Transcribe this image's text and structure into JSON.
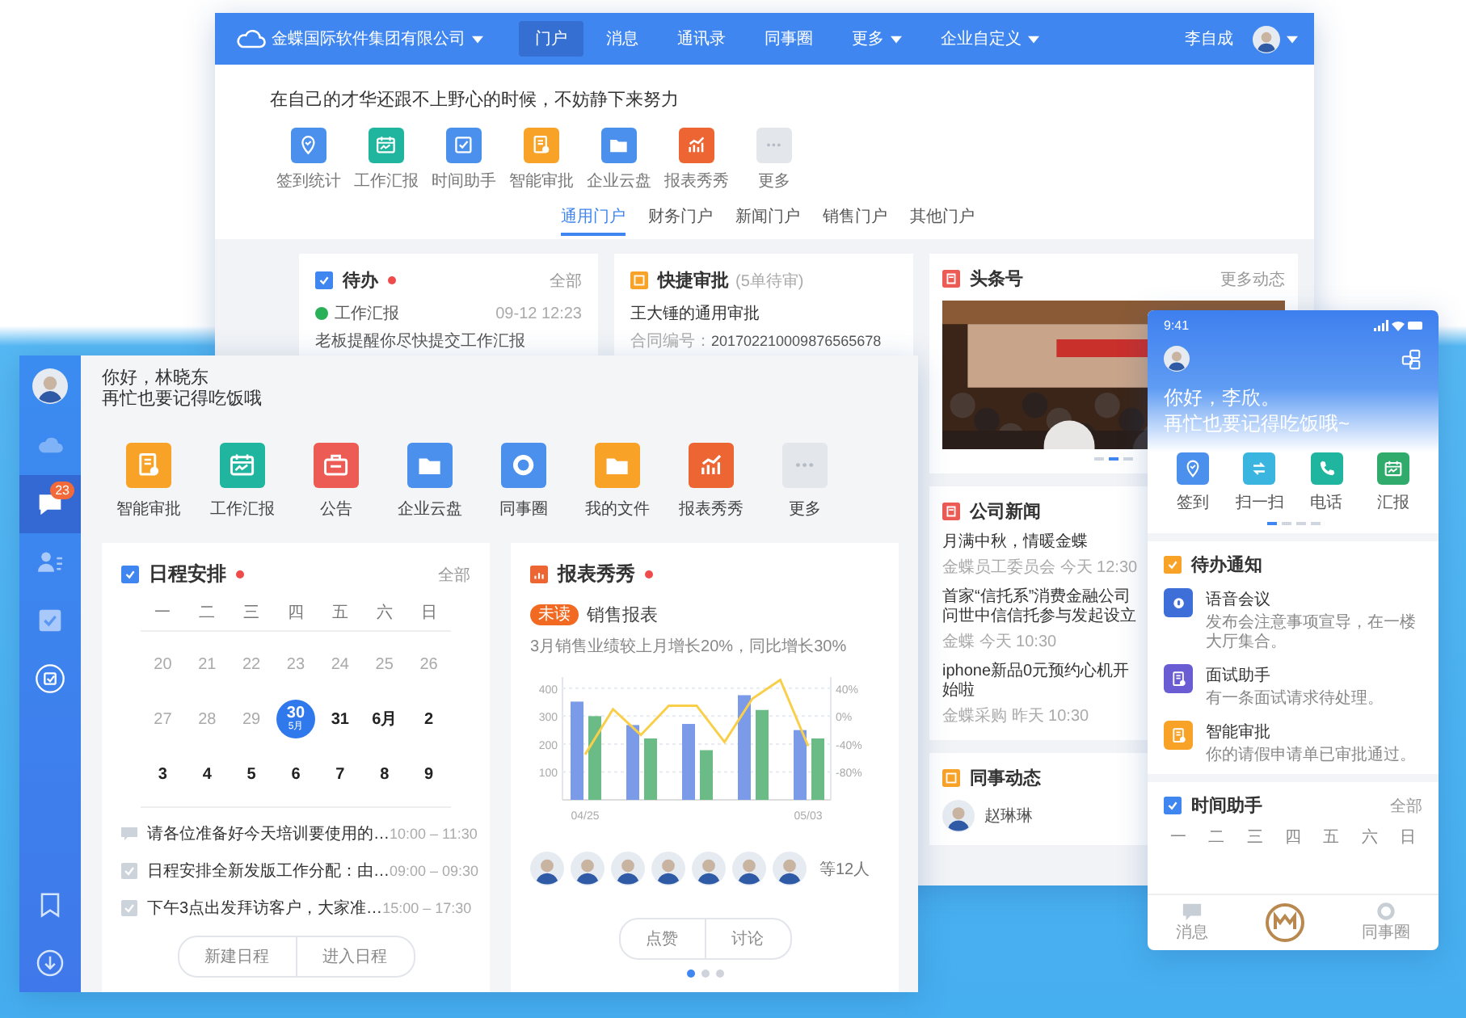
{
  "desktop_window": {
    "company": "金蝶国际软件集团有限公司",
    "nav": [
      {
        "label": "门户",
        "selected": true,
        "dropdown": false
      },
      {
        "label": "消息",
        "selected": false,
        "dropdown": false
      },
      {
        "label": "通讯录",
        "selected": false,
        "dropdown": false
      },
      {
        "label": "同事圈",
        "selected": false,
        "dropdown": false
      },
      {
        "label": "更多",
        "selected": false,
        "dropdown": true
      },
      {
        "label": "企业自定义",
        "selected": false,
        "dropdown": true
      }
    ],
    "user": "李自成",
    "slogan": "在自己的才华还跟不上野心的时候，不妨静下来努力",
    "apps": [
      "签到统计",
      "工作汇报",
      "时间助手",
      "智能审批",
      "企业云盘",
      "报表秀秀",
      "更多"
    ],
    "portal_tabs": [
      {
        "label": "通用门户",
        "selected": true
      },
      {
        "label": "财务门户",
        "selected": false
      },
      {
        "label": "新闻门户",
        "selected": false
      },
      {
        "label": "销售门户",
        "selected": false
      },
      {
        "label": "其他门户",
        "selected": false
      }
    ],
    "todo": {
      "title": "待办",
      "unread": true,
      "more": "全部",
      "item": {
        "title": "工作汇报",
        "time": "09-12 12:23",
        "text": "老板提醒你尽快提交工作汇报"
      }
    },
    "approval": {
      "title": "快捷审批",
      "note": "(5单待审)",
      "heading": "王大锤的通用审批",
      "label": "合同编号：",
      "value": "201702210009876565678"
    },
    "headline": {
      "title": "头条号",
      "more": "更多动态",
      "dots": [
        {
          "selected": false
        },
        {
          "selected": true
        },
        {
          "selected": false
        }
      ]
    },
    "news": {
      "title": "公司新闻",
      "items": [
        {
          "title": "月满中秋，情暖金蝶",
          "meta": "金蝶员工委员会 今天 12:30"
        },
        {
          "title": "首家“信托系”消费金融公司问世中信信托参与发起设立",
          "meta": "金蝶 今天 10:30"
        },
        {
          "title": "iphone新品0元预约心机开始啦",
          "meta": "金蝶采购 昨天 10:30"
        }
      ]
    },
    "colleagues": {
      "title": "同事动态",
      "name": "赵琳琳"
    }
  },
  "client_window": {
    "greeting": "你好，林晓东",
    "subtitle": "再忙也要记得吃饭哦",
    "sidebar": [
      {
        "selected": false
      },
      {
        "selected": true,
        "badge": "23"
      },
      {
        "selected": false
      },
      {
        "selected": false
      },
      {
        "selected": false
      },
      {
        "selected": false
      },
      {
        "selected": false
      }
    ],
    "apps": [
      "智能审批",
      "工作汇报",
      "公告",
      "企业云盘",
      "同事圈",
      "我的文件",
      "报表秀秀",
      "更多"
    ],
    "schedule": {
      "title": "日程安排",
      "unread": true,
      "more": "全部",
      "weekdays": [
        "一",
        "二",
        "三",
        "四",
        "五",
        "六",
        "日"
      ],
      "weeks": [
        [
          {
            "label": "20",
            "muted": true,
            "selected": false
          },
          {
            "label": "21",
            "muted": true,
            "selected": false
          },
          {
            "label": "22",
            "muted": true,
            "selected": false
          },
          {
            "label": "23",
            "muted": true,
            "selected": false
          },
          {
            "label": "24",
            "muted": true,
            "selected": false
          },
          {
            "label": "25",
            "muted": true,
            "selected": false
          },
          {
            "label": "26",
            "muted": true,
            "selected": false
          }
        ],
        [
          {
            "label": "27",
            "muted": true,
            "selected": false
          },
          {
            "label": "28",
            "muted": true,
            "selected": false
          },
          {
            "label": "29",
            "muted": true,
            "selected": false
          },
          {
            "label": "30",
            "sub": "5月",
            "muted": false,
            "selected": true
          },
          {
            "label": "31",
            "muted": false,
            "selected": false
          },
          {
            "label": "6月",
            "muted": false,
            "selected": false
          },
          {
            "label": "2",
            "muted": false,
            "selected": false
          }
        ],
        [
          {
            "label": "3",
            "muted": false,
            "selected": false
          },
          {
            "label": "4",
            "muted": false,
            "selected": false
          },
          {
            "label": "5",
            "muted": false,
            "selected": false
          },
          {
            "label": "6",
            "muted": false,
            "selected": false
          },
          {
            "label": "7",
            "muted": false,
            "selected": false
          },
          {
            "label": "8",
            "muted": false,
            "selected": false
          },
          {
            "label": "9",
            "muted": false,
            "selected": false
          }
        ]
      ],
      "events": [
        {
          "kind": "note",
          "text": "请各位准备好今天培训要使用的…",
          "time": "10:00 – 11:30"
        },
        {
          "kind": "task",
          "text": "日程安排全新发版工作分配：由…",
          "time": "09:00 – 09:30"
        },
        {
          "kind": "task",
          "text": "下午3点出发拜访客户，大家准…",
          "time": "15:00 – 17:30"
        }
      ],
      "actions": [
        "新建日程",
        "进入日程"
      ]
    },
    "report": {
      "title": "报表秀秀",
      "unread": true,
      "badge": "未读",
      "name": "销售报表",
      "summary": "3月销售业绩较上月增长20%，同比增长30%",
      "chart_data": {
        "type": "bar",
        "categories": [
          "04/25",
          null,
          null,
          null,
          null,
          null,
          null,
          null,
          "05/03"
        ],
        "grid": true,
        "ylim": [
          0,
          440
        ],
        "yticks": [
          100,
          200,
          300,
          400
        ],
        "y2lim": [
          -120,
          56
        ],
        "y2ticks": [
          {
            "value": 40,
            "label": "40%"
          },
          {
            "value": 0,
            "label": "0%"
          },
          {
            "value": -40,
            "label": "-40%"
          },
          {
            "value": -80,
            "label": "-80%"
          }
        ],
        "series": [
          {
            "color": "#7b9be8",
            "values": [
              352,
              null,
              268,
              null,
              272,
              null,
              375,
              null,
              250
            ]
          },
          {
            "color": "#6bbb87",
            "values": [
              300,
              null,
              220,
              null,
              178,
              null,
              322,
              null,
              220
            ]
          },
          {
            "color": "#f9cf4a",
            "type": "line",
            "axis": "y2",
            "values": [
              -55,
              10,
              -27,
              15,
              15,
              -37,
              25,
              52,
              -43
            ]
          }
        ]
      },
      "participants": "等12人",
      "actions": [
        "点赞",
        "讨论"
      ],
      "dots": [
        {
          "selected": true
        },
        {
          "selected": false
        },
        {
          "selected": false
        }
      ]
    }
  },
  "phone": {
    "time": "9:41",
    "greeting": "你好，李欣。",
    "subtitle": "再忙也要记得吃饭哦~",
    "apps": [
      "签到",
      "扫一扫",
      "电话",
      "汇报"
    ],
    "dots": [
      {
        "selected": true
      },
      {
        "selected": false
      },
      {
        "selected": false
      },
      {
        "selected": false
      }
    ],
    "todo": {
      "title": "待办通知",
      "items": [
        {
          "title": "语音会议",
          "text": "发布会注意事项宣导，在一楼大厅集合。"
        },
        {
          "title": "面试助手",
          "text": "有一条面试请求待处理。"
        },
        {
          "title": "智能审批",
          "text": "你的请假申请单已审批通过。"
        }
      ]
    },
    "time_helper": {
      "title": "时间助手",
      "more": "全部",
      "weekdays": [
        "一",
        "二",
        "三",
        "四",
        "五",
        "六",
        "日"
      ]
    },
    "tabs": [
      "消息",
      "同事圈"
    ]
  }
}
